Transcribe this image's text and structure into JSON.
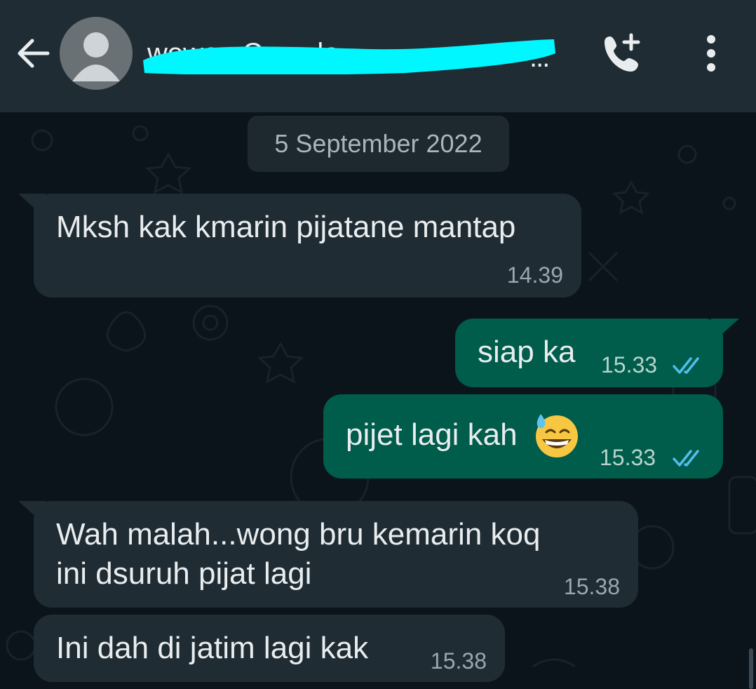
{
  "header": {
    "back_icon": "arrow-left-icon",
    "avatar_icon": "default-avatar-icon",
    "contact_name": "wowon Cemplo",
    "call_icon": "add-call-icon",
    "menu_icon": "more-vertical-icon"
  },
  "date_chip": "5 September 2022",
  "messages": [
    {
      "direction": "incoming",
      "text": "Mksh kak kmarin pijatane mantap",
      "time": "14.39"
    },
    {
      "direction": "outgoing",
      "text": "siap ka",
      "time": "15.33",
      "status_icon": "double-check-read-icon"
    },
    {
      "direction": "outgoing",
      "text": "pijet lagi kah",
      "emoji": "😅",
      "time": "15.33",
      "status_icon": "double-check-read-icon"
    },
    {
      "direction": "incoming",
      "text_lines": [
        "Wah malah...wong bru kemarin koq",
        "ini dsuruh pijat lagi"
      ],
      "time": "15.38"
    },
    {
      "direction": "incoming",
      "text": "Ini dah di jatim lagi kak",
      "time": "15.38"
    }
  ],
  "colors": {
    "header_bg": "#1f2c34",
    "chat_bg": "#0b141a",
    "incoming_bubble": "#1f2c33",
    "outgoing_bubble": "#005c4b",
    "read_ticks": "#53bdeb",
    "redaction": "#00f7ff"
  }
}
